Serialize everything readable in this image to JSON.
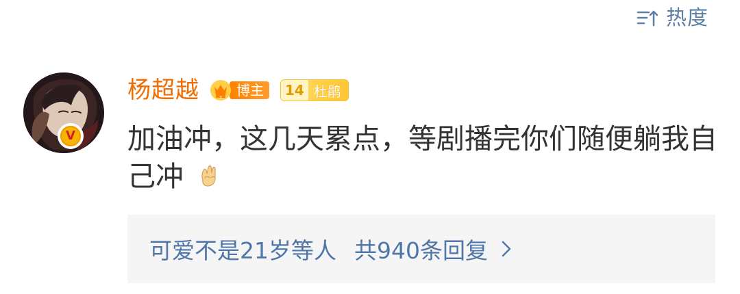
{
  "sort": {
    "label": "热度",
    "icon": "sort-icon",
    "color": "#5c7fa5"
  },
  "comment": {
    "username": "杨超越",
    "username_color": "#ef6d00",
    "blogger_badge": "博主",
    "fan_badge": {
      "level": "14",
      "name": "杜鹃"
    },
    "text": "加油冲，这几天累点，等剧播完你们随便躺我自己冲",
    "emoji": "rock-hand-emoji",
    "verified_badge": "V"
  },
  "replies": {
    "users": "可爱不是21岁等人",
    "count": "共940条回复",
    "chevron": "chevron-right-icon",
    "link_color": "#4f76a8"
  }
}
